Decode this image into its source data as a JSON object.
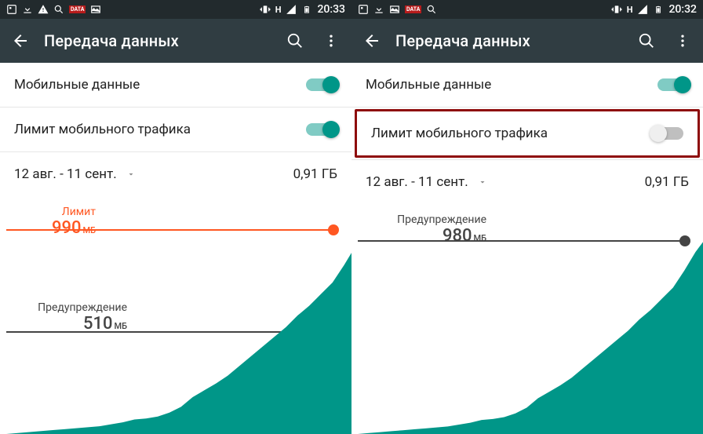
{
  "panes": [
    {
      "status": {
        "time": "20:33",
        "network_icon_label": "H"
      },
      "appbar": {
        "title": "Передача данных"
      },
      "rows": {
        "mobile_data": {
          "label": "Мобильные данные",
          "value": true
        },
        "data_limit": {
          "label": "Лимит мобильного трафика",
          "value": true,
          "highlighted": false
        }
      },
      "period": {
        "range": "12 авг. - 11 сент.",
        "total": "0,91 ГБ"
      },
      "chart_labels": {
        "limit": {
          "name": "Лимит",
          "value": "990",
          "unit": "МБ",
          "color": "#ff5722",
          "y_pct": 8
        },
        "warning": {
          "name": "Предупреждение",
          "value": "510",
          "unit": "МБ",
          "color": "#444",
          "y_pct": 52
        }
      }
    },
    {
      "status": {
        "time": "20:32",
        "network_icon_label": "H"
      },
      "appbar": {
        "title": "Передача данных"
      },
      "rows": {
        "mobile_data": {
          "label": "Мобильные данные",
          "value": true
        },
        "data_limit": {
          "label": "Лимит мобильного трафика",
          "value": false,
          "highlighted": true
        }
      },
      "period": {
        "range": "12 авг. - 11 сент.",
        "total": "0,91 ГБ"
      },
      "chart_labels": {
        "warning": {
          "name": "Предупреждение",
          "value": "980",
          "unit": "МБ",
          "color": "#444",
          "y_pct": 8
        }
      }
    }
  ],
  "chart_data": [
    {
      "type": "area",
      "title": "Передача данных",
      "xlabel": "",
      "ylabel": "МБ",
      "ylim": [
        0,
        1000
      ],
      "series": [
        {
          "name": "usage",
          "values": [
            5,
            8,
            12,
            15,
            18,
            20,
            24,
            27,
            30,
            36,
            40,
            50,
            55,
            62,
            80,
            110,
            150,
            180,
            210,
            240,
            280,
            320,
            360,
            400,
            440,
            480,
            520,
            560,
            610,
            680,
            760,
            820,
            870,
            900,
            910
          ]
        }
      ],
      "markers": [
        {
          "name": "Лимит",
          "value_mb": 990,
          "color": "#ff5722"
        },
        {
          "name": "Предупреждение",
          "value_mb": 510,
          "color": "#444"
        }
      ]
    },
    {
      "type": "area",
      "title": "Передача данных",
      "xlabel": "",
      "ylabel": "МБ",
      "ylim": [
        0,
        1000
      ],
      "series": [
        {
          "name": "usage",
          "values": [
            5,
            8,
            12,
            15,
            18,
            20,
            24,
            27,
            30,
            36,
            40,
            50,
            55,
            62,
            80,
            110,
            150,
            180,
            210,
            240,
            280,
            320,
            360,
            400,
            440,
            480,
            520,
            560,
            610,
            680,
            760,
            820,
            870,
            900,
            910
          ]
        }
      ],
      "markers": [
        {
          "name": "Предупреждение",
          "value_mb": 980,
          "color": "#444"
        }
      ]
    }
  ]
}
